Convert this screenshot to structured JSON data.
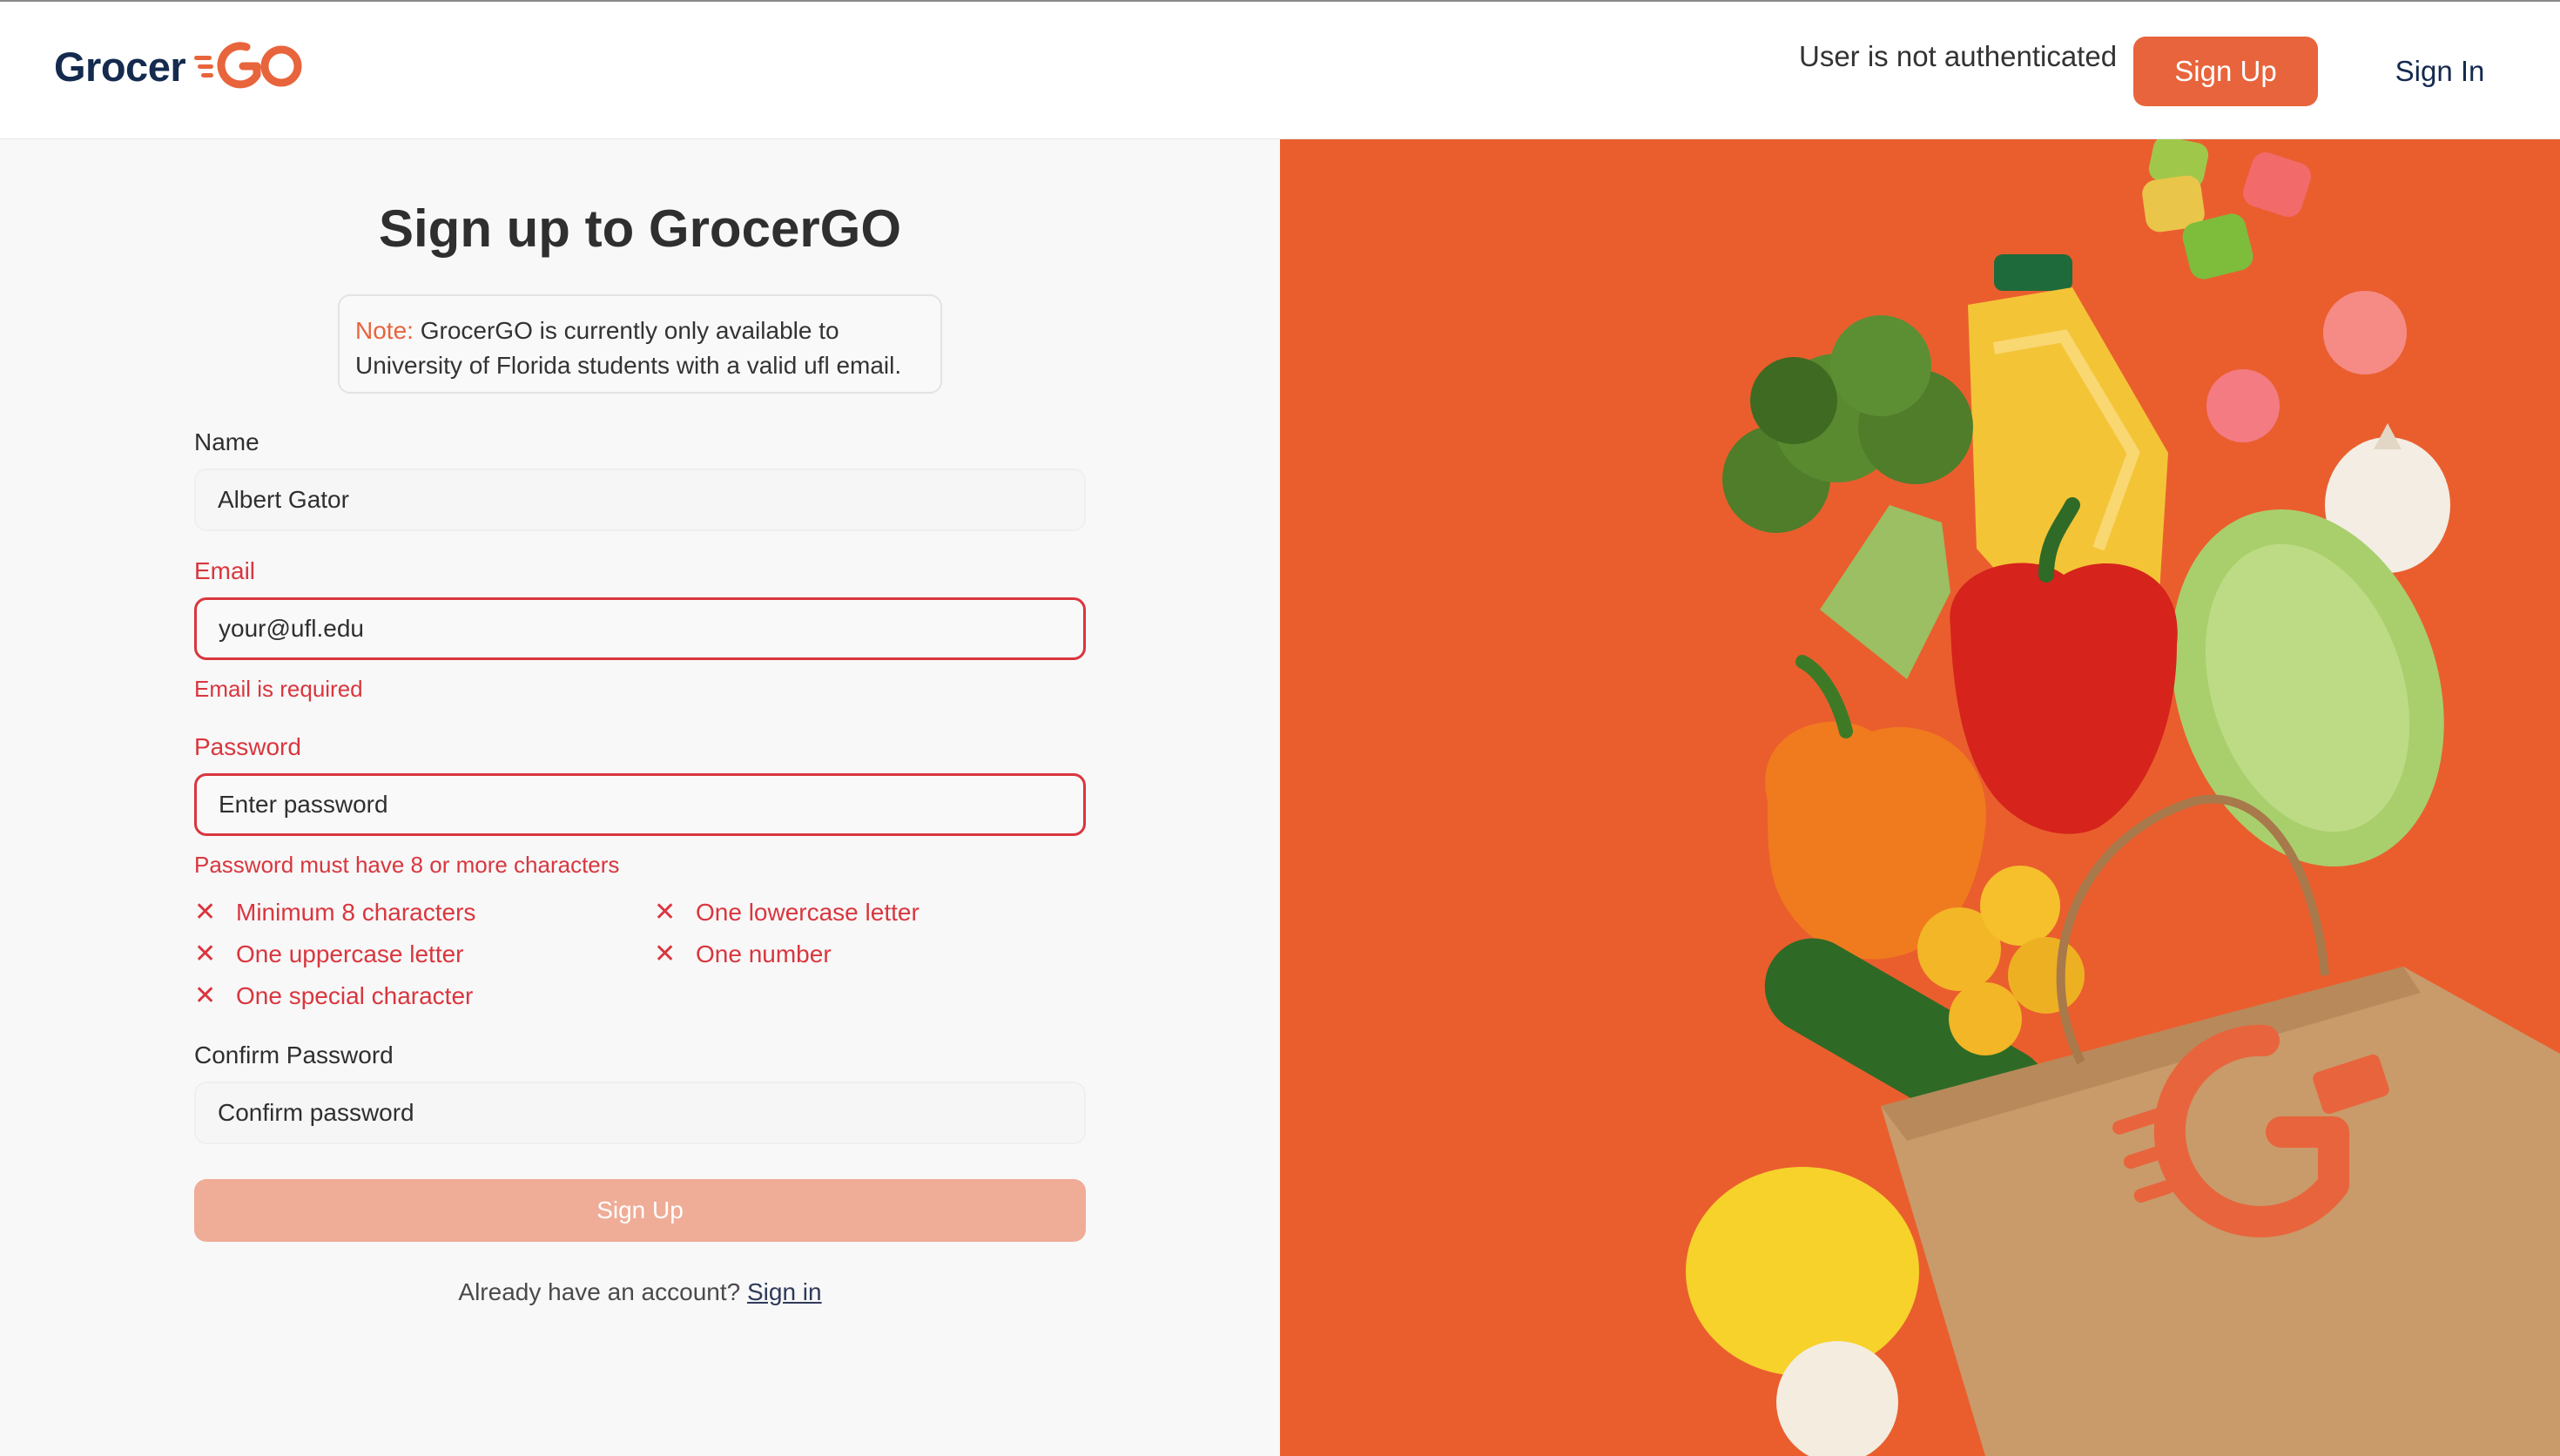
{
  "header": {
    "logo_text": "Grocer",
    "logo_go": "GO",
    "auth_status": "User is not authenticated",
    "signup_label": "Sign Up",
    "signin_label": "Sign In"
  },
  "form": {
    "title": "Sign up to GrocerGO",
    "note_label": "Note:",
    "note_text": " GrocerGO is currently only available to University of Florida students with a valid ufl email.",
    "name_label": "Name",
    "name_value": "Albert Gator",
    "email_label": "Email",
    "email_placeholder": "your@ufl.edu",
    "email_error": "Email is required",
    "password_label": "Password",
    "password_placeholder": "Enter password",
    "password_error": "Password must have 8 or more characters",
    "requirements": [
      "Minimum 8 characters",
      "One lowercase letter",
      "One uppercase letter",
      "One number",
      "One special character"
    ],
    "confirm_label": "Confirm Password",
    "confirm_placeholder": "Confirm password",
    "submit_label": "Sign Up",
    "footer_text": "Already have an account? ",
    "footer_link": "Sign in"
  },
  "colors": {
    "accent": "#e8643c",
    "error": "#d9363e",
    "navy": "#142a4e",
    "hero_background": "#ea5e2e"
  },
  "icons": {
    "requirement_fail": "close-x-icon",
    "bag_logo": "grocergo-g-cart-icon"
  }
}
